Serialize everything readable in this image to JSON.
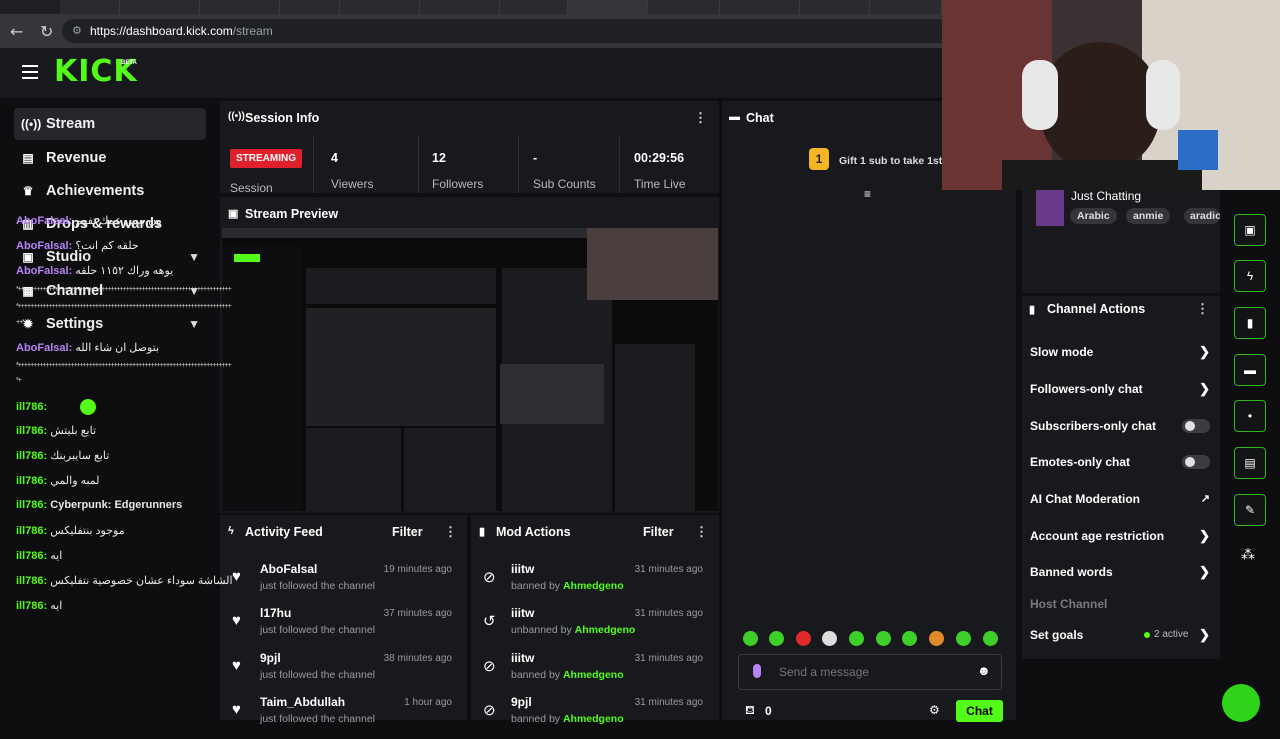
{
  "browser": {
    "url_host": "https://dashboard.kick.com",
    "url_path": "/stream"
  },
  "brand": {
    "logo": "KICK",
    "beta": "BETA",
    "accent": "#53fc18",
    "live_red": "#e0202a"
  },
  "sidebar": {
    "items": [
      {
        "label": "Stream",
        "icon": "broadcast-icon",
        "active": true
      },
      {
        "label": "Revenue",
        "icon": "chart-icon"
      },
      {
        "label": "Achievements",
        "icon": "trophy-icon"
      },
      {
        "label": "Drops & rewards",
        "icon": "gift-icon"
      },
      {
        "label": "Studio",
        "icon": "studio-icon",
        "expandable": true
      },
      {
        "label": "Channel",
        "icon": "channel-icon",
        "expandable": true
      },
      {
        "label": "Settings",
        "icon": "gear-icon",
        "expandable": true
      }
    ]
  },
  "session": {
    "title": "Session Info",
    "status": "STREAMING",
    "status_label": "Session",
    "stats": [
      {
        "value": "4",
        "label": "Viewers"
      },
      {
        "value": "12",
        "label": "Followers"
      },
      {
        "value": "-",
        "label": "Sub Counts"
      },
      {
        "value": "00:29:56",
        "label": "Time Live"
      }
    ]
  },
  "preview": {
    "title": "Stream Preview"
  },
  "activity": {
    "title": "Activity Feed",
    "filter": "Filter",
    "rows": [
      {
        "name": "AboFalsal",
        "action": "just followed the channel",
        "time": "19 minutes ago"
      },
      {
        "name": "l17hu",
        "action": "just followed the channel",
        "time": "37 minutes ago"
      },
      {
        "name": "9pjl",
        "action": "just followed the channel",
        "time": "38 minutes ago"
      },
      {
        "name": "Taim_Abdullah",
        "action": "just followed the channel",
        "time": "1 hour ago"
      }
    ]
  },
  "mod": {
    "title": "Mod Actions",
    "filter": "Filter",
    "rows": [
      {
        "name": "iiitw",
        "action": "banned by",
        "by": "Ahmedgeno",
        "time": "31 minutes ago",
        "icon": "ban-icon"
      },
      {
        "name": "iiitw",
        "action": "unbanned by",
        "by": "Ahmedgeno",
        "time": "31 minutes ago",
        "icon": "undo-icon"
      },
      {
        "name": "iiitw",
        "action": "banned by",
        "by": "Ahmedgeno",
        "time": "31 minutes ago",
        "icon": "ban-icon"
      },
      {
        "name": "9pjl",
        "action": "banned by",
        "by": "Ahmedgeno",
        "time": "31 minutes ago",
        "icon": "ban-icon"
      }
    ]
  },
  "chat": {
    "title": "Chat",
    "gift_count": "1",
    "gift_text": "Gift 1 sub to take 1st",
    "messages": [
      {
        "user": "AboFalsal",
        "text": "ون بيس عمك تفهم",
        "kind": "u1"
      },
      {
        "user": "AboFalsal",
        "text": "حلقه كم انت؟",
        "kind": "u1"
      },
      {
        "user": "AboFalsal",
        "text": "يوهه وراك ١١٥٢ حلقه",
        "kind": "u1"
      },
      {
        "user": "AboFalsal",
        "text": "بتوصل ان شاء الله",
        "kind": "u1"
      },
      {
        "user": "ill786",
        "text": "",
        "kind": "u2",
        "emote": true
      },
      {
        "user": "ill786",
        "text": "تابع بليتش",
        "kind": "u2"
      },
      {
        "user": "ill786",
        "text": "تابع سايبربنك",
        "kind": "u2"
      },
      {
        "user": "ill786",
        "text": "لمبه والمي",
        "kind": "u2"
      },
      {
        "user": "ill786",
        "text": "Cyberpunk: Edgerunners",
        "kind": "u2"
      },
      {
        "user": "ill786",
        "text": "موجود بنتفليكس",
        "kind": "u2"
      },
      {
        "user": "ill786",
        "text": "ايه",
        "kind": "u2"
      },
      {
        "user": "ill786",
        "text": "الشاشة سوداء عشان خصوصية نتفليكس",
        "kind": "u2"
      },
      {
        "user": "ill786",
        "text": "ايه",
        "kind": "u2"
      }
    ],
    "hashes_a": "*+++++++++++++++++++++++++++++++++++++++++++++++++++++++++++++++++++++",
    "hashes_a_tail": "++*",
    "hashes_b": "*+++++++++++++++++++++++++++++++++++++++++++++++++++++++++++++++++++++",
    "hashes_b_tail": "*+",
    "input_placeholder": "Send a message",
    "viewer_count": "0",
    "send_label": "Chat"
  },
  "category": {
    "name": "Just Chatting",
    "tags": [
      "Arabic",
      "anmie",
      "aradic"
    ]
  },
  "channel_actions": {
    "title": "Channel Actions",
    "rows": [
      {
        "label": "Slow mode",
        "control": "chevron"
      },
      {
        "label": "Followers-only chat",
        "control": "chevron"
      },
      {
        "label": "Subscribers-only chat",
        "control": "toggle"
      },
      {
        "label": "Emotes-only chat",
        "control": "toggle"
      },
      {
        "label": "AI Chat Moderation",
        "control": "external"
      },
      {
        "label": "Account age restriction",
        "control": "chevron"
      },
      {
        "label": "Banned words",
        "control": "chevron"
      }
    ],
    "host_channel": "Host Channel",
    "goals_label": "Set goals",
    "goals_status": "2 active"
  }
}
